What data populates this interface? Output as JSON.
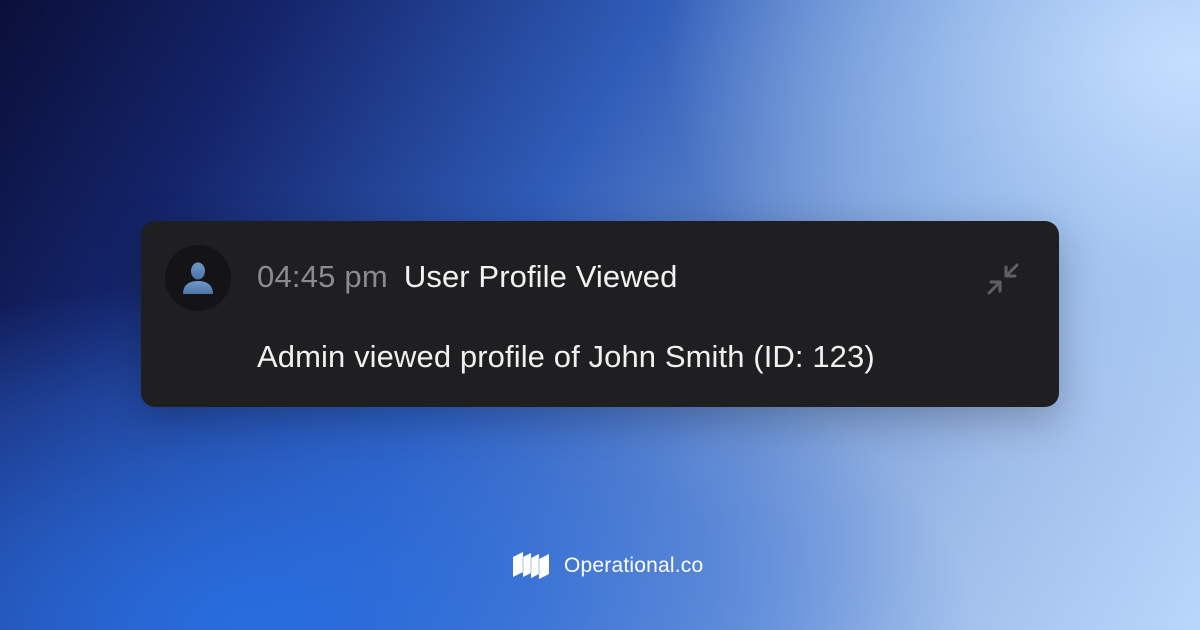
{
  "event": {
    "time": "04:45 pm",
    "title": "User Profile Viewed",
    "description": "Admin viewed profile of John Smith (ID: 123)",
    "avatar_icon": "user-silhouette-icon",
    "collapse_icon": "collapse-arrows-icon"
  },
  "brand": {
    "name": "Operational.co",
    "logo_icon": "operational-logo-icon"
  },
  "colors": {
    "card_background": "#1f1f21",
    "time_text": "#8a8b8f",
    "title_text": "#f2f2f2",
    "avatar_figure": "#5a83b5"
  }
}
